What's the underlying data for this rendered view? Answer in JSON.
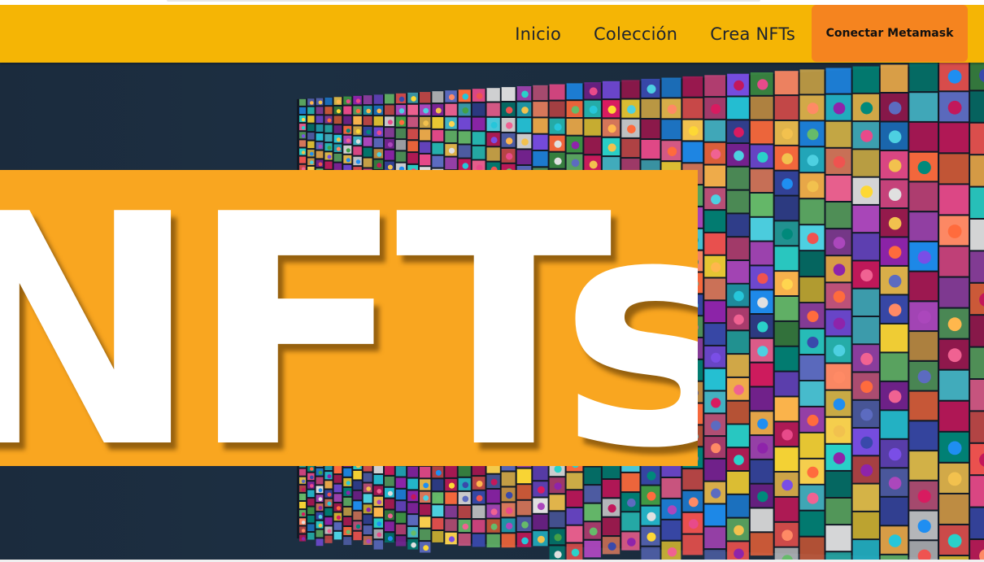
{
  "nav": {
    "links": [
      "Inicio",
      "Colección",
      "Crea NFTs"
    ],
    "connect_label": "Conectar Metamask"
  },
  "hero": {
    "banner_text": "NFTs",
    "mosaic_image": "nft-artwork-collage"
  },
  "colors": {
    "navbar": "#f5b505",
    "connect_button": "#f5841f",
    "banner": "#f9a620",
    "hero_background": "#1b2b3d"
  }
}
